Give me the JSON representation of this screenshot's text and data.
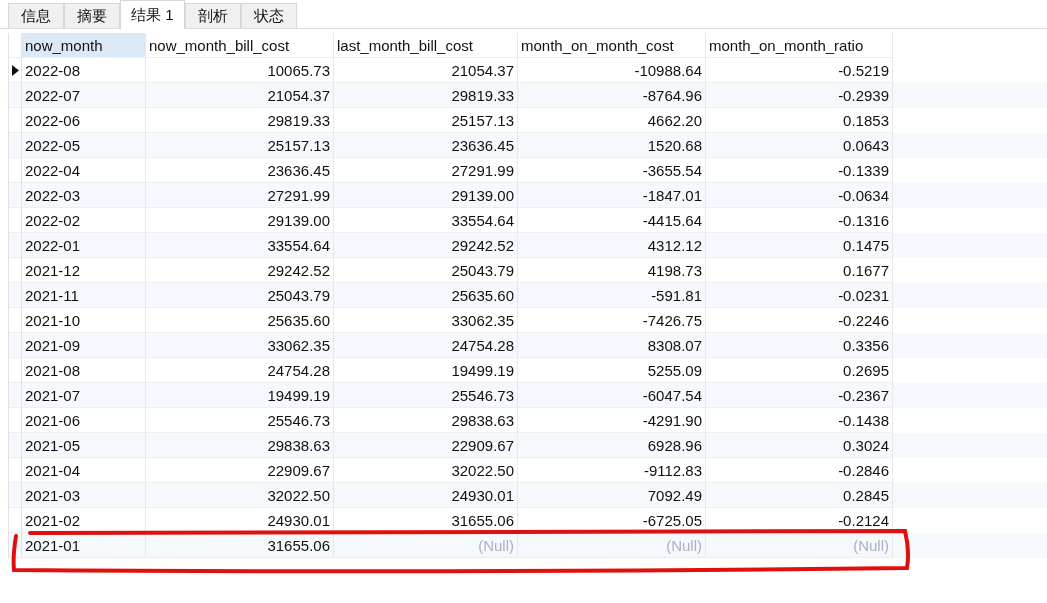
{
  "tabs": [
    {
      "label": "信息",
      "selected": false
    },
    {
      "label": "摘要",
      "selected": false
    },
    {
      "label": "结果 1",
      "selected": true
    },
    {
      "label": "剖析",
      "selected": false
    },
    {
      "label": "状态",
      "selected": false
    }
  ],
  "table": {
    "columns": [
      {
        "label": "now_month",
        "selected": true
      },
      {
        "label": "now_month_bill_cost",
        "selected": false
      },
      {
        "label": "last_month_bill_cost",
        "selected": false
      },
      {
        "label": "month_on_month_cost",
        "selected": false
      },
      {
        "label": "month_on_month_ratio",
        "selected": false
      }
    ],
    "rows": [
      {
        "current": true,
        "cells": [
          "2022-08",
          "10065.73",
          "21054.37",
          "-10988.64",
          "-0.5219"
        ],
        "null": [
          false,
          false,
          false,
          false,
          false
        ]
      },
      {
        "current": false,
        "cells": [
          "2022-07",
          "21054.37",
          "29819.33",
          "-8764.96",
          "-0.2939"
        ],
        "null": [
          false,
          false,
          false,
          false,
          false
        ]
      },
      {
        "current": false,
        "cells": [
          "2022-06",
          "29819.33",
          "25157.13",
          "4662.20",
          "0.1853"
        ],
        "null": [
          false,
          false,
          false,
          false,
          false
        ]
      },
      {
        "current": false,
        "cells": [
          "2022-05",
          "25157.13",
          "23636.45",
          "1520.68",
          "0.0643"
        ],
        "null": [
          false,
          false,
          false,
          false,
          false
        ]
      },
      {
        "current": false,
        "cells": [
          "2022-04",
          "23636.45",
          "27291.99",
          "-3655.54",
          "-0.1339"
        ],
        "null": [
          false,
          false,
          false,
          false,
          false
        ]
      },
      {
        "current": false,
        "cells": [
          "2022-03",
          "27291.99",
          "29139.00",
          "-1847.01",
          "-0.0634"
        ],
        "null": [
          false,
          false,
          false,
          false,
          false
        ]
      },
      {
        "current": false,
        "cells": [
          "2022-02",
          "29139.00",
          "33554.64",
          "-4415.64",
          "-0.1316"
        ],
        "null": [
          false,
          false,
          false,
          false,
          false
        ]
      },
      {
        "current": false,
        "cells": [
          "2022-01",
          "33554.64",
          "29242.52",
          "4312.12",
          "0.1475"
        ],
        "null": [
          false,
          false,
          false,
          false,
          false
        ]
      },
      {
        "current": false,
        "cells": [
          "2021-12",
          "29242.52",
          "25043.79",
          "4198.73",
          "0.1677"
        ],
        "null": [
          false,
          false,
          false,
          false,
          false
        ]
      },
      {
        "current": false,
        "cells": [
          "2021-11",
          "25043.79",
          "25635.60",
          "-591.81",
          "-0.0231"
        ],
        "null": [
          false,
          false,
          false,
          false,
          false
        ]
      },
      {
        "current": false,
        "cells": [
          "2021-10",
          "25635.60",
          "33062.35",
          "-7426.75",
          "-0.2246"
        ],
        "null": [
          false,
          false,
          false,
          false,
          false
        ]
      },
      {
        "current": false,
        "cells": [
          "2021-09",
          "33062.35",
          "24754.28",
          "8308.07",
          "0.3356"
        ],
        "null": [
          false,
          false,
          false,
          false,
          false
        ]
      },
      {
        "current": false,
        "cells": [
          "2021-08",
          "24754.28",
          "19499.19",
          "5255.09",
          "0.2695"
        ],
        "null": [
          false,
          false,
          false,
          false,
          false
        ]
      },
      {
        "current": false,
        "cells": [
          "2021-07",
          "19499.19",
          "25546.73",
          "-6047.54",
          "-0.2367"
        ],
        "null": [
          false,
          false,
          false,
          false,
          false
        ]
      },
      {
        "current": false,
        "cells": [
          "2021-06",
          "25546.73",
          "29838.63",
          "-4291.90",
          "-0.1438"
        ],
        "null": [
          false,
          false,
          false,
          false,
          false
        ]
      },
      {
        "current": false,
        "cells": [
          "2021-05",
          "29838.63",
          "22909.67",
          "6928.96",
          "0.3024"
        ],
        "null": [
          false,
          false,
          false,
          false,
          false
        ]
      },
      {
        "current": false,
        "cells": [
          "2021-04",
          "22909.67",
          "32022.50",
          "-9112.83",
          "-0.2846"
        ],
        "null": [
          false,
          false,
          false,
          false,
          false
        ]
      },
      {
        "current": false,
        "cells": [
          "2021-03",
          "32022.50",
          "24930.01",
          "7092.49",
          "0.2845"
        ],
        "null": [
          false,
          false,
          false,
          false,
          false
        ]
      },
      {
        "current": false,
        "cells": [
          "2021-02",
          "24930.01",
          "31655.06",
          "-6725.05",
          "-0.2124"
        ],
        "null": [
          false,
          false,
          false,
          false,
          false
        ]
      },
      {
        "current": false,
        "cells": [
          "2021-01",
          "31655.06",
          "(Null)",
          "(Null)",
          "(Null)"
        ],
        "null": [
          false,
          false,
          true,
          true,
          true
        ]
      }
    ]
  }
}
